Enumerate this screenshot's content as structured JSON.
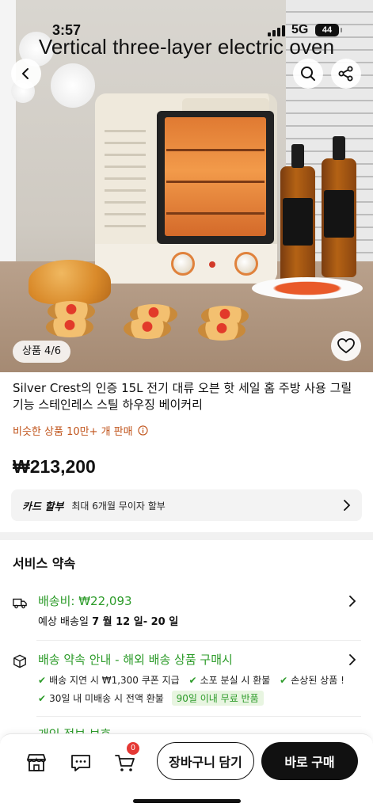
{
  "status_bar": {
    "time": "3:57",
    "network": "5G",
    "battery": "44"
  },
  "hero": {
    "overlay_title": "Vertical three-layer electric oven",
    "page_indicator": "상품 4/6",
    "back_icon": "chevron-left-icon",
    "search_icon": "search-icon",
    "share_icon": "share-icon",
    "wishlist_icon": "heart-icon"
  },
  "product": {
    "name": "Silver Crest의 인증 15L 전기 대류 오븐 핫 세일 홈 주방 사용 그릴 기능 스테인레스 스틸 하우징 베이커리",
    "sold_text": "비슷한 상품 10만+ 개 판매",
    "price": "₩213,200"
  },
  "card_installment": {
    "label": "카드 할부",
    "text": "최대 6개월 무이자 할부"
  },
  "service": {
    "title": "서비스 약속",
    "shipping": {
      "fee": "배송비: ₩22,093",
      "eta_prefix": "예상 배송일",
      "eta_dates": "7 월 12 일- 20 일"
    },
    "guarantee": {
      "title": "배송 약속 안내 - 해외 배송 상품 구매시",
      "bullets_row1": [
        "배송 지연 시 ₩1,300 쿠폰 지급",
        "소포 분실 시 환불",
        "손상된 상품 !"
      ],
      "bullets_row2": [
        "30일 내 미배송 시 전액 환불"
      ],
      "free_return_tag": "90일 이내 무료 반품"
    },
    "privacy_partial": "개인 정보 보호"
  },
  "bottom_bar": {
    "cart_badge": "0",
    "add_to_cart": "장바구니 담기",
    "buy_now": "바로 구매"
  },
  "colors": {
    "accent_green": "#2c9b29",
    "sold_orange": "#c0531a",
    "badge_red": "#e53935",
    "oven_orange": "#e0823c"
  }
}
